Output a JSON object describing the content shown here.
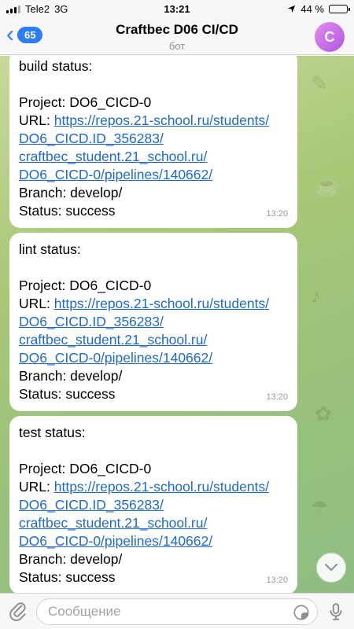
{
  "status_bar": {
    "carrier": "Tele2",
    "network": "3G",
    "time": "13:21",
    "battery_text": "44 %",
    "battery_level": 0.44
  },
  "header": {
    "back_count": "65",
    "title": "Craftbec D06 CI/CD",
    "subtitle": "бот",
    "avatar_letter": "C"
  },
  "messages": [
    {
      "heading": "build status:",
      "project": "Project: DO6_CICD-0",
      "url_prefix": "URL: ",
      "url_lines": [
        "https://repos.21-school.ru/students/",
        "DO6_CICD.ID_356283/",
        "craftbec_student.21_school.ru/",
        "DO6_CICD-0/pipelines/140662/"
      ],
      "branch": "Branch: develop/",
      "status": "Status: success",
      "time": "13:20"
    },
    {
      "heading": "lint status:",
      "project": "Project: DO6_CICD-0",
      "url_prefix": "URL: ",
      "url_lines": [
        "https://repos.21-school.ru/students/",
        "DO6_CICD.ID_356283/",
        "craftbec_student.21_school.ru/",
        "DO6_CICD-0/pipelines/140662/"
      ],
      "branch": "Branch: develop/",
      "status": "Status: success",
      "time": "13:20"
    },
    {
      "heading": "test status:",
      "project": "Project: DO6_CICD-0",
      "url_prefix": "URL: ",
      "url_lines": [
        "https://repos.21-school.ru/students/",
        "DO6_CICD.ID_356283/",
        "craftbec_student.21_school.ru/",
        "DO6_CICD-0/pipelines/140662/"
      ],
      "branch": "Branch: develop/",
      "status": "Status: success",
      "time": "13:20"
    }
  ],
  "input": {
    "placeholder": "Сообщение"
  },
  "icons": {
    "back": "chevron-left-icon",
    "attach": "paperclip-icon",
    "sticker": "sticker-icon",
    "mic": "microphone-icon",
    "scroll": "chevron-down-icon"
  },
  "colors": {
    "accent": "#2c7ef5",
    "link": "#1f6ac7",
    "avatar": "#c46be6"
  }
}
